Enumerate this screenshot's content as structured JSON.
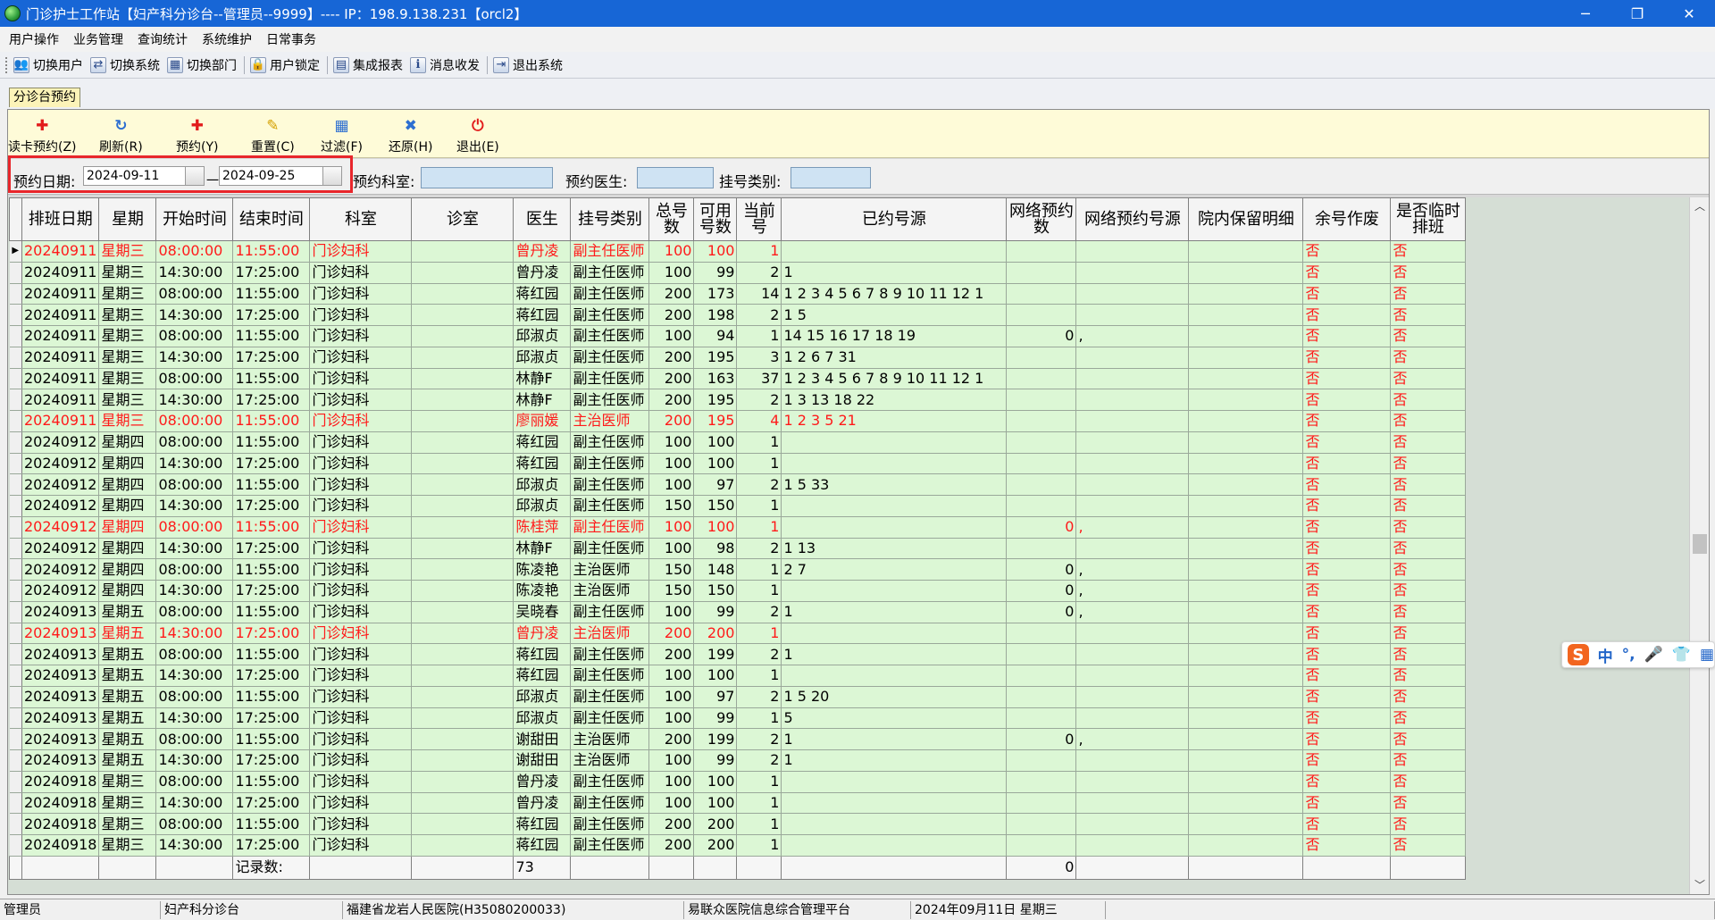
{
  "window": {
    "title": "门诊护士工作站【妇产科分诊台--管理员--9999】---- IP：198.9.138.231【orcl2】",
    "minimize": "─",
    "restore": "❐",
    "close": "✕"
  },
  "menu": [
    "用户操作",
    "业务管理",
    "查询统计",
    "系统维护",
    "日常事务"
  ],
  "quickbar": [
    {
      "label": "切换用户",
      "icon": "users-icon",
      "glyph": "👥"
    },
    {
      "label": "切换系统",
      "icon": "switch-system-icon",
      "glyph": "⇄"
    },
    {
      "label": "切换部门",
      "icon": "switch-dept-icon",
      "glyph": "▦"
    },
    {
      "label": "用户锁定",
      "icon": "user-lock-icon",
      "glyph": "🔒"
    },
    {
      "label": "集成报表",
      "icon": "report-icon",
      "glyph": "▤"
    },
    {
      "label": "消息收发",
      "icon": "info-icon",
      "glyph": "ℹ"
    },
    {
      "label": "退出系统",
      "icon": "exit-icon",
      "glyph": "⇥"
    }
  ],
  "tab": {
    "label": "分诊台预约"
  },
  "toolbar": [
    {
      "label": "读卡预约(Z)",
      "icon": "card-read-icon",
      "glyph": "✚",
      "color": "#e21b1b"
    },
    {
      "label": "刷新(R)",
      "icon": "refresh-icon",
      "glyph": "↻",
      "color": "#2d6fd1"
    },
    {
      "label": "预约(Y)",
      "icon": "reserve-icon",
      "glyph": "✚",
      "color": "#e21b1b"
    },
    {
      "label": "重置(C)",
      "icon": "reset-icon",
      "glyph": "✎",
      "color": "#d4a000"
    },
    {
      "label": "过滤(F)",
      "icon": "filter-icon",
      "glyph": "▦",
      "color": "#2d6fd1"
    },
    {
      "label": "还原(H)",
      "icon": "restore-icon",
      "glyph": "✖",
      "color": "#2d6fd1"
    },
    {
      "label": "退出(E)",
      "icon": "power-icon",
      "glyph": "⏻",
      "color": "#e21b1b"
    }
  ],
  "filter": {
    "date_label": "预约日期:",
    "date_from": "2024-09-11",
    "date_to": "2024-09-25",
    "dash": "一",
    "dept_label": "预约科室:",
    "doctor_label": "预约医生:",
    "type_label": "挂号类别:"
  },
  "columns": [
    "排班日期",
    "星期",
    "开始时间",
    "结束时间",
    "科室",
    "诊室",
    "医生",
    "挂号类别",
    "总号数",
    "可用号数",
    "当前号",
    "已约号源",
    "网络预约数",
    "网络预约号源",
    "院内保留明细",
    "余号作废",
    "是否临时排班"
  ],
  "rows": [
    {
      "date": "20240911",
      "week": "星期三",
      "start": "08:00:00",
      "end": "11:55:00",
      "dept": "门诊妇科",
      "room": "",
      "doctor": "曾丹凌",
      "type": "副主任医师",
      "total": "100",
      "avail": "100",
      "cur": "1",
      "booked": "",
      "netcnt": "",
      "netsrc": "",
      "reserve": "",
      "void": "否",
      "temp": "否",
      "red": true
    },
    {
      "date": "20240911",
      "week": "星期三",
      "start": "14:30:00",
      "end": "17:25:00",
      "dept": "门诊妇科",
      "room": "",
      "doctor": "曾丹凌",
      "type": "副主任医师",
      "total": "100",
      "avail": "99",
      "cur": "2",
      "booked": "1",
      "netcnt": "",
      "netsrc": "",
      "reserve": "",
      "void": "否",
      "temp": "否"
    },
    {
      "date": "20240911",
      "week": "星期三",
      "start": "08:00:00",
      "end": "11:55:00",
      "dept": "门诊妇科",
      "room": "",
      "doctor": "蒋红园",
      "type": "副主任医师",
      "total": "200",
      "avail": "173",
      "cur": "14",
      "booked": "1 2 3 4 5 6 7 8 9 10 11 12 1",
      "netcnt": "",
      "netsrc": "",
      "reserve": "",
      "void": "否",
      "temp": "否"
    },
    {
      "date": "20240911",
      "week": "星期三",
      "start": "14:30:00",
      "end": "17:25:00",
      "dept": "门诊妇科",
      "room": "",
      "doctor": "蒋红园",
      "type": "副主任医师",
      "total": "200",
      "avail": "198",
      "cur": "2",
      "booked": "1 5",
      "netcnt": "",
      "netsrc": "",
      "reserve": "",
      "void": "否",
      "temp": "否"
    },
    {
      "date": "20240911",
      "week": "星期三",
      "start": "08:00:00",
      "end": "11:55:00",
      "dept": "门诊妇科",
      "room": "",
      "doctor": "邱淑贞",
      "type": "副主任医师",
      "total": "100",
      "avail": "94",
      "cur": "1",
      "booked": "14 15 16 17 18 19",
      "netcnt": "0",
      "netsrc": ",",
      "reserve": "",
      "void": "否",
      "temp": "否"
    },
    {
      "date": "20240911",
      "week": "星期三",
      "start": "14:30:00",
      "end": "17:25:00",
      "dept": "门诊妇科",
      "room": "",
      "doctor": "邱淑贞",
      "type": "副主任医师",
      "total": "200",
      "avail": "195",
      "cur": "3",
      "booked": "1 2 6 7 31",
      "netcnt": "",
      "netsrc": "",
      "reserve": "",
      "void": "否",
      "temp": "否"
    },
    {
      "date": "20240911",
      "week": "星期三",
      "start": "08:00:00",
      "end": "11:55:00",
      "dept": "门诊妇科",
      "room": "",
      "doctor": "林静F",
      "type": "副主任医师",
      "total": "200",
      "avail": "163",
      "cur": "37",
      "booked": "1 2 3 4 5 6 7 8 9 10 11 12 1",
      "netcnt": "",
      "netsrc": "",
      "reserve": "",
      "void": "否",
      "temp": "否"
    },
    {
      "date": "20240911",
      "week": "星期三",
      "start": "14:30:00",
      "end": "17:25:00",
      "dept": "门诊妇科",
      "room": "",
      "doctor": "林静F",
      "type": "副主任医师",
      "total": "200",
      "avail": "195",
      "cur": "2",
      "booked": "1 3 13 18 22",
      "netcnt": "",
      "netsrc": "",
      "reserve": "",
      "void": "否",
      "temp": "否"
    },
    {
      "date": "20240911",
      "week": "星期三",
      "start": "08:00:00",
      "end": "11:55:00",
      "dept": "门诊妇科",
      "room": "",
      "doctor": "廖丽媛",
      "type": "主治医师",
      "total": "200",
      "avail": "195",
      "cur": "4",
      "booked": "1 2 3 5 21",
      "netcnt": "",
      "netsrc": "",
      "reserve": "",
      "void": "否",
      "temp": "否",
      "red": true
    },
    {
      "date": "20240912",
      "week": "星期四",
      "start": "08:00:00",
      "end": "11:55:00",
      "dept": "门诊妇科",
      "room": "",
      "doctor": "蒋红园",
      "type": "副主任医师",
      "total": "100",
      "avail": "100",
      "cur": "1",
      "booked": "",
      "netcnt": "",
      "netsrc": "",
      "reserve": "",
      "void": "否",
      "temp": "否"
    },
    {
      "date": "20240912",
      "week": "星期四",
      "start": "14:30:00",
      "end": "17:25:00",
      "dept": "门诊妇科",
      "room": "",
      "doctor": "蒋红园",
      "type": "副主任医师",
      "total": "100",
      "avail": "100",
      "cur": "1",
      "booked": "",
      "netcnt": "",
      "netsrc": "",
      "reserve": "",
      "void": "否",
      "temp": "否"
    },
    {
      "date": "20240912",
      "week": "星期四",
      "start": "08:00:00",
      "end": "11:55:00",
      "dept": "门诊妇科",
      "room": "",
      "doctor": "邱淑贞",
      "type": "副主任医师",
      "total": "100",
      "avail": "97",
      "cur": "2",
      "booked": "1 5 33",
      "netcnt": "",
      "netsrc": "",
      "reserve": "",
      "void": "否",
      "temp": "否"
    },
    {
      "date": "20240912",
      "week": "星期四",
      "start": "14:30:00",
      "end": "17:25:00",
      "dept": "门诊妇科",
      "room": "",
      "doctor": "邱淑贞",
      "type": "副主任医师",
      "total": "150",
      "avail": "150",
      "cur": "1",
      "booked": "",
      "netcnt": "",
      "netsrc": "",
      "reserve": "",
      "void": "否",
      "temp": "否"
    },
    {
      "date": "20240912",
      "week": "星期四",
      "start": "08:00:00",
      "end": "11:55:00",
      "dept": "门诊妇科",
      "room": "",
      "doctor": "陈桂萍",
      "type": "副主任医师",
      "total": "100",
      "avail": "100",
      "cur": "1",
      "booked": "",
      "netcnt": "0",
      "netsrc": ",",
      "reserve": "",
      "void": "否",
      "temp": "否",
      "red": true
    },
    {
      "date": "20240912",
      "week": "星期四",
      "start": "14:30:00",
      "end": "17:25:00",
      "dept": "门诊妇科",
      "room": "",
      "doctor": "林静F",
      "type": "副主任医师",
      "total": "100",
      "avail": "98",
      "cur": "2",
      "booked": "1 13",
      "netcnt": "",
      "netsrc": "",
      "reserve": "",
      "void": "否",
      "temp": "否"
    },
    {
      "date": "20240912",
      "week": "星期四",
      "start": "08:00:00",
      "end": "11:55:00",
      "dept": "门诊妇科",
      "room": "",
      "doctor": "陈凌艳",
      "type": "主治医师",
      "total": "150",
      "avail": "148",
      "cur": "1",
      "booked": "2 7",
      "netcnt": "0",
      "netsrc": ",",
      "reserve": "",
      "void": "否",
      "temp": "否"
    },
    {
      "date": "20240912",
      "week": "星期四",
      "start": "14:30:00",
      "end": "17:25:00",
      "dept": "门诊妇科",
      "room": "",
      "doctor": "陈凌艳",
      "type": "主治医师",
      "total": "150",
      "avail": "150",
      "cur": "1",
      "booked": "",
      "netcnt": "0",
      "netsrc": ",",
      "reserve": "",
      "void": "否",
      "temp": "否"
    },
    {
      "date": "20240913",
      "week": "星期五",
      "start": "08:00:00",
      "end": "11:55:00",
      "dept": "门诊妇科",
      "room": "",
      "doctor": "吴晓春",
      "type": "副主任医师",
      "total": "100",
      "avail": "99",
      "cur": "2",
      "booked": "1",
      "netcnt": "0",
      "netsrc": ",",
      "reserve": "",
      "void": "否",
      "temp": "否"
    },
    {
      "date": "20240913",
      "week": "星期五",
      "start": "14:30:00",
      "end": "17:25:00",
      "dept": "门诊妇科",
      "room": "",
      "doctor": "曾丹凌",
      "type": "主治医师",
      "total": "200",
      "avail": "200",
      "cur": "1",
      "booked": "",
      "netcnt": "",
      "netsrc": "",
      "reserve": "",
      "void": "否",
      "temp": "否",
      "red": true
    },
    {
      "date": "20240913",
      "week": "星期五",
      "start": "08:00:00",
      "end": "11:55:00",
      "dept": "门诊妇科",
      "room": "",
      "doctor": "蒋红园",
      "type": "副主任医师",
      "total": "200",
      "avail": "199",
      "cur": "2",
      "booked": "1",
      "netcnt": "",
      "netsrc": "",
      "reserve": "",
      "void": "否",
      "temp": "否"
    },
    {
      "date": "20240913",
      "week": "星期五",
      "start": "14:30:00",
      "end": "17:25:00",
      "dept": "门诊妇科",
      "room": "",
      "doctor": "蒋红园",
      "type": "副主任医师",
      "total": "100",
      "avail": "100",
      "cur": "1",
      "booked": "",
      "netcnt": "",
      "netsrc": "",
      "reserve": "",
      "void": "否",
      "temp": "否"
    },
    {
      "date": "20240913",
      "week": "星期五",
      "start": "08:00:00",
      "end": "11:55:00",
      "dept": "门诊妇科",
      "room": "",
      "doctor": "邱淑贞",
      "type": "副主任医师",
      "total": "100",
      "avail": "97",
      "cur": "2",
      "booked": "1 5 20",
      "netcnt": "",
      "netsrc": "",
      "reserve": "",
      "void": "否",
      "temp": "否"
    },
    {
      "date": "20240913",
      "week": "星期五",
      "start": "14:30:00",
      "end": "17:25:00",
      "dept": "门诊妇科",
      "room": "",
      "doctor": "邱淑贞",
      "type": "副主任医师",
      "total": "100",
      "avail": "99",
      "cur": "1",
      "booked": "5",
      "netcnt": "",
      "netsrc": "",
      "reserve": "",
      "void": "否",
      "temp": "否"
    },
    {
      "date": "20240913",
      "week": "星期五",
      "start": "08:00:00",
      "end": "11:55:00",
      "dept": "门诊妇科",
      "room": "",
      "doctor": "谢甜田",
      "type": "主治医师",
      "total": "200",
      "avail": "199",
      "cur": "2",
      "booked": "1",
      "netcnt": "0",
      "netsrc": ",",
      "reserve": "",
      "void": "否",
      "temp": "否"
    },
    {
      "date": "20240913",
      "week": "星期五",
      "start": "14:30:00",
      "end": "17:25:00",
      "dept": "门诊妇科",
      "room": "",
      "doctor": "谢甜田",
      "type": "主治医师",
      "total": "100",
      "avail": "99",
      "cur": "2",
      "booked": "1",
      "netcnt": "",
      "netsrc": "",
      "reserve": "",
      "void": "否",
      "temp": "否"
    },
    {
      "date": "20240918",
      "week": "星期三",
      "start": "08:00:00",
      "end": "11:55:00",
      "dept": "门诊妇科",
      "room": "",
      "doctor": "曾丹凌",
      "type": "副主任医师",
      "total": "100",
      "avail": "100",
      "cur": "1",
      "booked": "",
      "netcnt": "",
      "netsrc": "",
      "reserve": "",
      "void": "否",
      "temp": "否"
    },
    {
      "date": "20240918",
      "week": "星期三",
      "start": "14:30:00",
      "end": "17:25:00",
      "dept": "门诊妇科",
      "room": "",
      "doctor": "曾丹凌",
      "type": "副主任医师",
      "total": "100",
      "avail": "100",
      "cur": "1",
      "booked": "",
      "netcnt": "",
      "netsrc": "",
      "reserve": "",
      "void": "否",
      "temp": "否"
    },
    {
      "date": "20240918",
      "week": "星期三",
      "start": "08:00:00",
      "end": "11:55:00",
      "dept": "门诊妇科",
      "room": "",
      "doctor": "蒋红园",
      "type": "副主任医师",
      "total": "200",
      "avail": "200",
      "cur": "1",
      "booked": "",
      "netcnt": "",
      "netsrc": "",
      "reserve": "",
      "void": "否",
      "temp": "否"
    },
    {
      "date": "20240918",
      "week": "星期三",
      "start": "14:30:00",
      "end": "17:25:00",
      "dept": "门诊妇科",
      "room": "",
      "doctor": "蒋红园",
      "type": "副主任医师",
      "total": "200",
      "avail": "200",
      "cur": "1",
      "booked": "",
      "netcnt": "",
      "netsrc": "",
      "reserve": "",
      "void": "否",
      "temp": "否"
    }
  ],
  "summary": {
    "label": "记录数:",
    "count": "73",
    "netcnt": "0"
  },
  "ime": {
    "logo": "S",
    "mode": "中",
    "punct": "°,"
  },
  "status": [
    "管理员",
    "妇产科分诊台",
    "福建省龙岩人民医院(H35080200033)",
    "易联众医院信息综合管理平台",
    "2024年09月11日 星期三",
    ""
  ]
}
